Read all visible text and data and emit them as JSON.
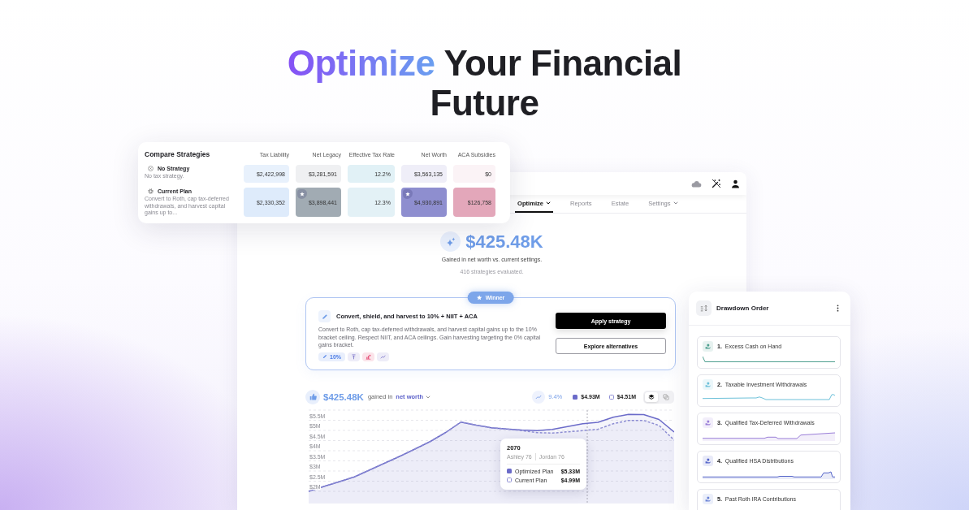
{
  "headline": {
    "highlight": "Optimize",
    "text": "Your Financial Future"
  },
  "compare_strategies": {
    "title": "Compare Strategies",
    "columns": [
      "Tax Liability",
      "Net Legacy",
      "Effective Tax Rate",
      "Net Worth",
      "ACA Subsidies"
    ],
    "rows": [
      {
        "name": "No Strategy",
        "description": "No tax strategy.",
        "cells": [
          {
            "value": "$2,422,998",
            "color": "#e8f1fc",
            "starred": false
          },
          {
            "value": "$3,281,591",
            "color": "#eff0f2",
            "starred": false
          },
          {
            "value": "12.2%",
            "color": "#e1f1f6",
            "starred": false
          },
          {
            "value": "$3,563,135",
            "color": "#efeef8",
            "starred": false
          },
          {
            "value": "$0",
            "color": "#fbf3f6",
            "starred": false
          }
        ]
      },
      {
        "name": "Current Plan",
        "description": "Convert to Roth, cap tax-deferred withdrawals, and harvest capital gains up to...",
        "cells": [
          {
            "value": "$2,330,352",
            "color": "#deebfb",
            "starred": false
          },
          {
            "value": "$3,898,441",
            "color": "#a1abb3",
            "starred": true
          },
          {
            "value": "12.3%",
            "color": "#e3f1f6",
            "starred": false
          },
          {
            "value": "$4,930,891",
            "color": "#8e8ecf",
            "starred": true
          },
          {
            "value": "$126,758",
            "color": "#e3a7ba",
            "starred": false
          }
        ]
      }
    ]
  },
  "app": {
    "nav": [
      {
        "label": "Optimize",
        "selected": true,
        "dropdown": true
      },
      {
        "label": "Reports",
        "selected": false,
        "dropdown": false
      },
      {
        "label": "Estate",
        "selected": false,
        "dropdown": false
      },
      {
        "label": "Settings",
        "selected": false,
        "dropdown": true
      }
    ],
    "summary": {
      "amount": "$425.48K",
      "caption": "Gained in net worth vs. current settings.",
      "note": "416 strategies evaluated."
    },
    "winner": {
      "badge": "Winner",
      "title": "Convert, shield, and harvest to 10% + NIIT + ACA",
      "description": "Convert to Roth, cap tax-deferred withdrawals, and harvest capital gains up to the 10% bracket ceiling. Respect NIIT, and ACA ceilings. Gain harvesting targeting the 0% capital gains bracket.",
      "tags": [
        {
          "kind": "label",
          "label": "10%",
          "color": "#e9effc"
        },
        {
          "kind": "icon",
          "color": "#eeedf8"
        },
        {
          "kind": "icon",
          "color": "#fbe4ea"
        },
        {
          "kind": "icon",
          "color": "#eeedf8"
        }
      ],
      "actions": [
        {
          "label": "Apply strategy",
          "kind": "primary"
        },
        {
          "label": "Explore alternatives",
          "kind": "secondary"
        }
      ]
    },
    "results": {
      "amount": "$425.48K",
      "text": "gained in",
      "metric": "net worth",
      "growth": "9.4%",
      "legend": [
        {
          "kind": "filled",
          "label": "$4.93M"
        },
        {
          "kind": "outline",
          "label": "$4.51M"
        }
      ],
      "view_toggle": [
        {
          "selected": true
        },
        {
          "selected": false
        }
      ],
      "chart_data": {
        "type": "area",
        "grid": true,
        "legend": "lower right",
        "ylim": [
          1.4,
          6
        ],
        "yticks": [
          {
            "value": 2,
            "label": "$2M"
          },
          {
            "value": 2.5,
            "label": "$2.5M"
          },
          {
            "value": 3,
            "label": "$3M"
          },
          {
            "value": 3.5,
            "label": "$3.5M"
          },
          {
            "value": 4,
            "label": "$4M"
          },
          {
            "value": 4.5,
            "label": "$4.5M"
          },
          {
            "value": 5,
            "label": "$5M"
          },
          {
            "value": 5.5,
            "label": "$5.5M"
          }
        ],
        "series": [
          {
            "name": "Optimized Plan",
            "color": "#6b6bc9",
            "values": [
              2.0,
              2.24,
              2.47,
              2.71,
              3.05,
              3.39,
              3.73,
              4.09,
              4.46,
              4.9,
              5.41,
              5.26,
              5.13,
              5.07,
              5.02,
              4.99,
              5.05,
              5.19,
              5.33,
              5.4,
              5.65,
              5.79,
              5.78,
              5.54,
              4.92
            ]
          },
          {
            "name": "Current Plan",
            "color": "#8d8dd3",
            "values": [
              2.0,
              2.24,
              2.47,
              2.71,
              3.05,
              3.39,
              3.73,
              4.09,
              4.46,
              4.9,
              5.41,
              5.26,
              5.13,
              5.07,
              4.99,
              4.89,
              4.87,
              4.93,
              4.99,
              5.06,
              5.33,
              5.49,
              5.49,
              5.25,
              4.52
            ]
          }
        ]
      },
      "tooltip": {
        "title": "2070",
        "ages": [
          "Ashley 76",
          "Jordan 76"
        ],
        "values": [
          "$5.33M",
          "$4.99M"
        ]
      }
    }
  },
  "drawdown": {
    "title": "Drawdown Order",
    "items": [
      {
        "number": "1.",
        "label": "Excess Cash on Hand",
        "color": "#4e9f8f"
      },
      {
        "number": "2.",
        "label": "Taxable Investment Withdrawals",
        "color": "#6cc0d9"
      },
      {
        "number": "3.",
        "label": "Qualified Tax-Deferred Withdrawals",
        "color": "#9a7ed8"
      },
      {
        "number": "4.",
        "label": "Qualified HSA Distributions",
        "color": "#5464c9"
      },
      {
        "number": "5.",
        "label": "Past Roth IRA Contributions",
        "color": "#6c84d6"
      }
    ]
  }
}
